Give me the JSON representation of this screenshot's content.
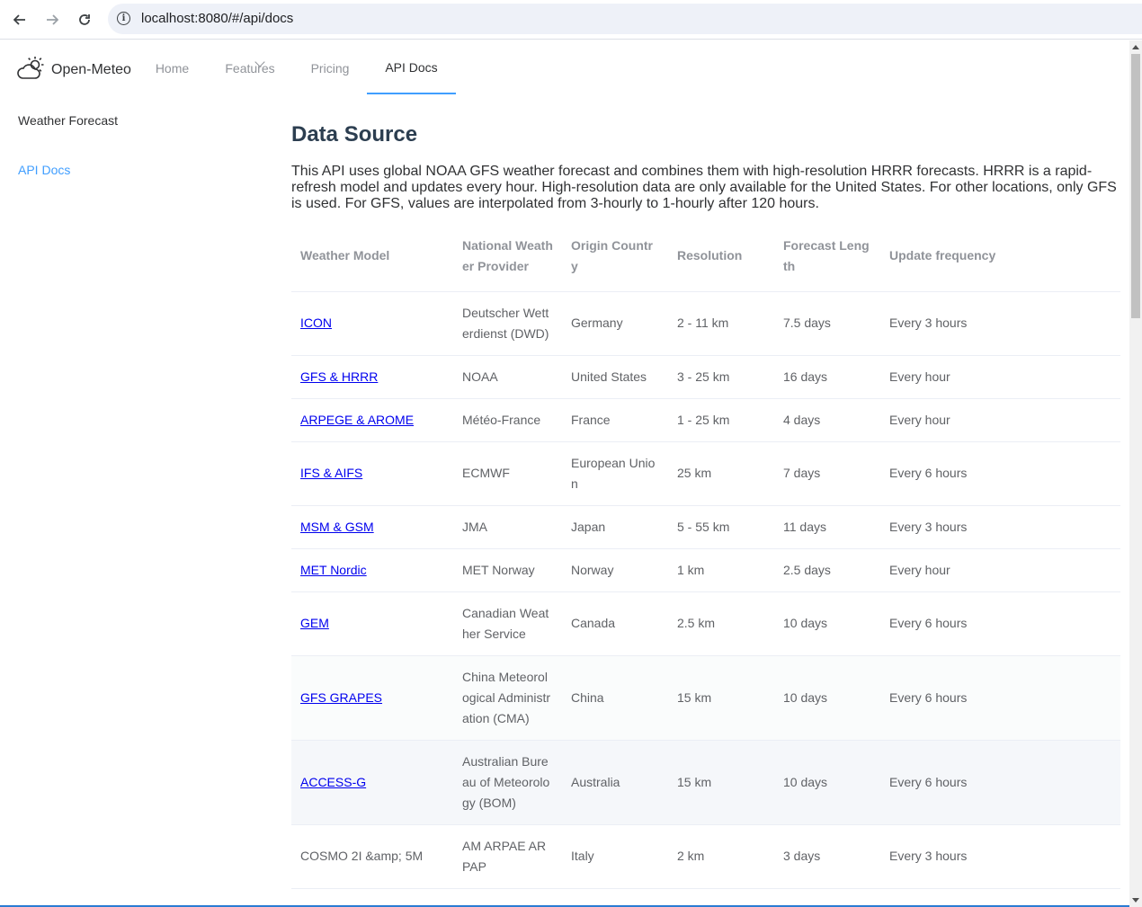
{
  "browser": {
    "url": "localhost:8080/#/api/docs",
    "back_icon": "arrow-left",
    "forward_icon": "arrow-right",
    "reload_icon": "reload",
    "info_icon": "info"
  },
  "header": {
    "brand": "Open-Meteo",
    "nav": [
      {
        "label": "Home"
      },
      {
        "label": "Features"
      },
      {
        "label": "Pricing"
      },
      {
        "label": "API Docs"
      }
    ],
    "active_tab": "API Docs",
    "accent_color": "#409eff"
  },
  "sidebar": {
    "items": [
      {
        "label": "Weather Forecast"
      },
      {
        "label": "API Docs"
      }
    ]
  },
  "main": {
    "title": "Data Source",
    "intro": " This API uses global NOAA GFS weather forecast and combines them with high-resolution HRRR forecasts. HRRR is a rapid-refresh model and updates every hour. High-resolution data are only available for the United States. For other locations, only GFS is used. For GFS, values are interpolated from 3-hourly to 1-hourly after 120 hours.",
    "table": {
      "headers": [
        "Weather Model",
        "National Weather Provider",
        "Origin Country",
        "Resolution",
        "Forecast Length",
        "Update frequency"
      ],
      "rows": [
        {
          "model": "ICON",
          "provider": "Deutscher Wetterdienst (DWD)",
          "country": "Germany",
          "resolution": "2 - 11 km",
          "length": "7.5 days",
          "frequency": "Every 3 hours"
        },
        {
          "model": "GFS & HRRR",
          "provider": "NOAA",
          "country": "United States",
          "resolution": "3 - 25 km",
          "length": "16 days",
          "frequency": "Every hour"
        },
        {
          "model": "ARPEGE & AROME",
          "provider": "Météo-France",
          "country": "France",
          "resolution": "1 - 25 km",
          "length": "4 days",
          "frequency": "Every hour"
        },
        {
          "model": "IFS & AIFS",
          "provider": "ECMWF",
          "country": "European Union",
          "resolution": "25 km",
          "length": "7 days",
          "frequency": "Every 6 hours"
        },
        {
          "model": "MSM & GSM",
          "provider": "JMA",
          "country": "Japan",
          "resolution": "5 - 55 km",
          "length": "11 days",
          "frequency": "Every 3 hours"
        },
        {
          "model": "MET Nordic",
          "provider": "MET Norway",
          "country": "Norway",
          "resolution": "1 km",
          "length": "2.5 days",
          "frequency": "Every hour"
        },
        {
          "model": "GEM",
          "provider": "Canadian Weather Service",
          "country": "Canada",
          "resolution": "2.5 km",
          "length": "10 days",
          "frequency": "Every 6 hours"
        },
        {
          "model": "GFS GRAPES",
          "provider": "China Meteorological Administration (CMA)",
          "country": "China",
          "resolution": "15 km",
          "length": "10 days",
          "frequency": "Every 6 hours"
        },
        {
          "model": "ACCESS-G",
          "provider": "Australian Bureau of Meteorology (BOM)",
          "country": "Australia",
          "resolution": "15 km",
          "length": "10 days",
          "frequency": "Every 6 hours"
        },
        {
          "model": "COSMO 2I &amp; 5M",
          "provider": "AM ARPAE ARPAP",
          "country": "Italy",
          "resolution": "2 km",
          "length": "3 days",
          "frequency": "Every 3 hours"
        }
      ]
    }
  }
}
